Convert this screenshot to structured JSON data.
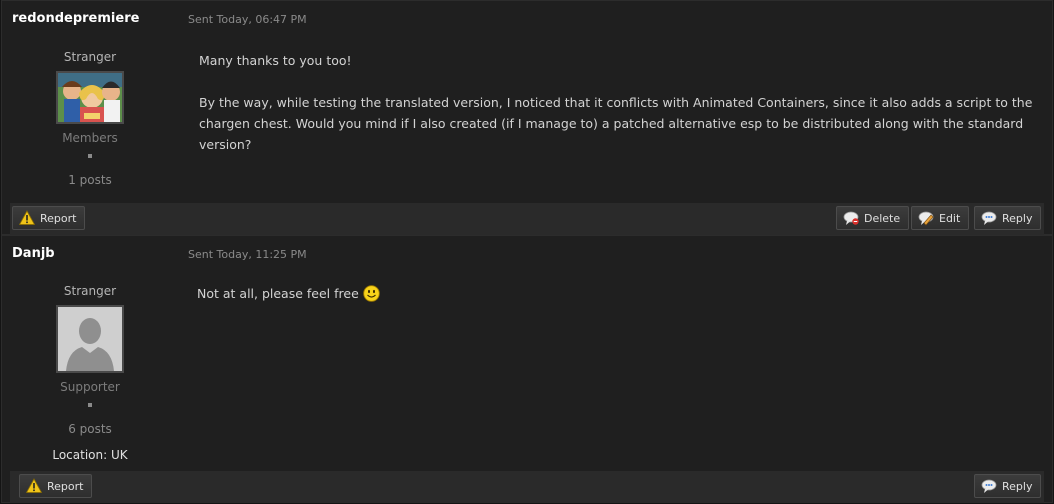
{
  "posts": [
    {
      "author": "redondepremiere",
      "sent": "Sent Today, 06:47 PM",
      "rank": "Stranger",
      "group": "Members",
      "post_count": "1 posts",
      "body": [
        "Many thanks to you too!",
        "By the way, while testing the translated version, I noticed that it conflicts with Animated Containers, since it also adds a script to the chargen chest. Would you mind if I also created (if I manage to) a patched alternative esp to be distributed along with the standard version?"
      ],
      "buttons": {
        "report": "Report",
        "delete": "Delete",
        "edit": "Edit",
        "reply": "Reply"
      }
    },
    {
      "author": "Danjb",
      "sent": "Sent Today, 11:25 PM",
      "rank": "Stranger",
      "group": "Supporter",
      "post_count": "6 posts",
      "location": "Location: UK",
      "body": [
        "Not at all, please feel free"
      ],
      "buttons": {
        "report": "Report",
        "reply": "Reply"
      }
    }
  ],
  "icons": {
    "report": "warning-icon",
    "delete": "delete-bubble-icon",
    "edit": "edit-bubble-icon",
    "reply": "reply-bubble-icon",
    "smiley": "smiley-icon"
  },
  "colors": {
    "background": "#1f1f1f",
    "controls_bar": "#2a2a2a",
    "author": "#ffffff",
    "muted": "#8a8a8a"
  }
}
